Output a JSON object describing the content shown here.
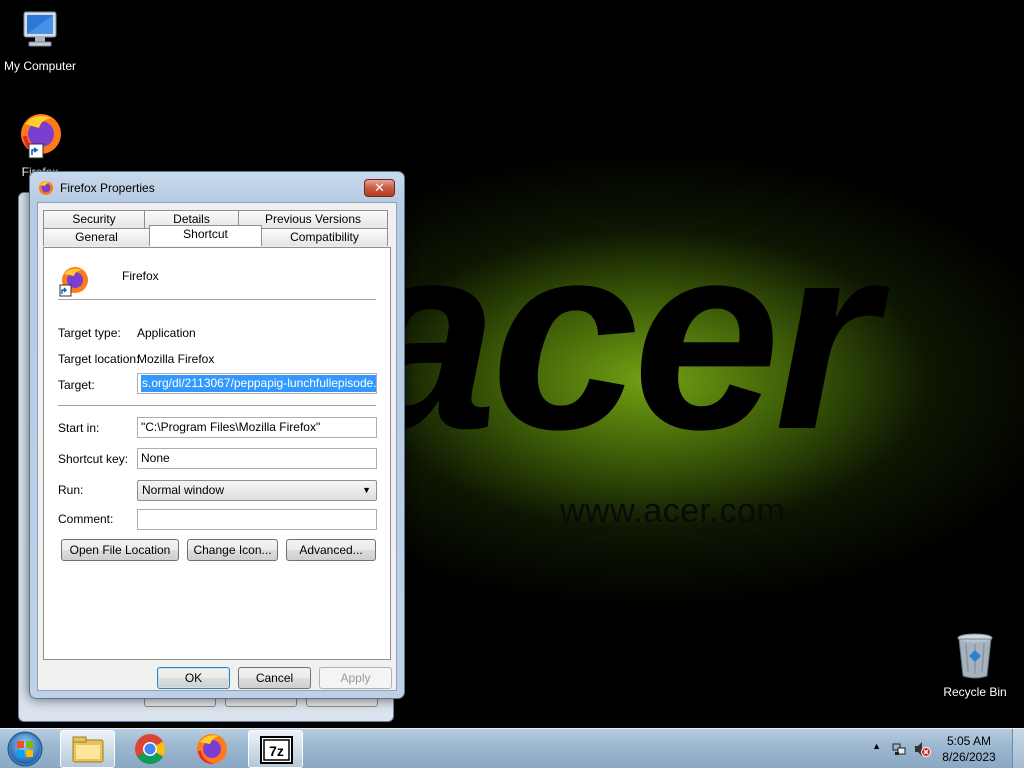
{
  "desktop": {
    "brand_logo": "acer",
    "brand_url": "www.acer.com",
    "icons": [
      {
        "label": "My Computer",
        "icon": "computer-icon"
      },
      {
        "label": "Firefox",
        "icon": "firefox-icon"
      },
      {
        "label": "Recycle Bin",
        "icon": "recycle-bin-icon"
      }
    ]
  },
  "dialog": {
    "title": "Firefox Properties",
    "close_label": "✕",
    "tabs_row1": [
      "Security",
      "Details",
      "Previous Versions"
    ],
    "tabs_row2": [
      "General",
      "Shortcut",
      "Compatibility"
    ],
    "active_tab": "Shortcut",
    "app_name": "Firefox",
    "target_type_label": "Target type:",
    "target_type_value": "Application",
    "target_location_label": "Target location:",
    "target_location_value": "Mozilla Firefox",
    "target_label": "Target:",
    "target_value": "s.org/dl/2113067/peppapig-lunchfullepisode.mp4",
    "start_in_label": "Start in:",
    "start_in_value": "\"C:\\Program Files\\Mozilla Firefox\"",
    "shortcut_key_label": "Shortcut key:",
    "shortcut_key_value": "None",
    "run_label": "Run:",
    "run_value": "Normal window",
    "comment_label": "Comment:",
    "comment_value": "",
    "buttons": {
      "open_file_location": "Open File Location",
      "change_icon": "Change Icon...",
      "advanced": "Advanced...",
      "ok": "OK",
      "cancel": "Cancel",
      "apply": "Apply"
    }
  },
  "taskbar": {
    "time": "5:05 AM",
    "date": "8/26/2023",
    "pinned": [
      "explorer-icon",
      "chrome-icon",
      "firefox-icon",
      "7zip-icon"
    ],
    "seven_zip_label": "7z"
  }
}
